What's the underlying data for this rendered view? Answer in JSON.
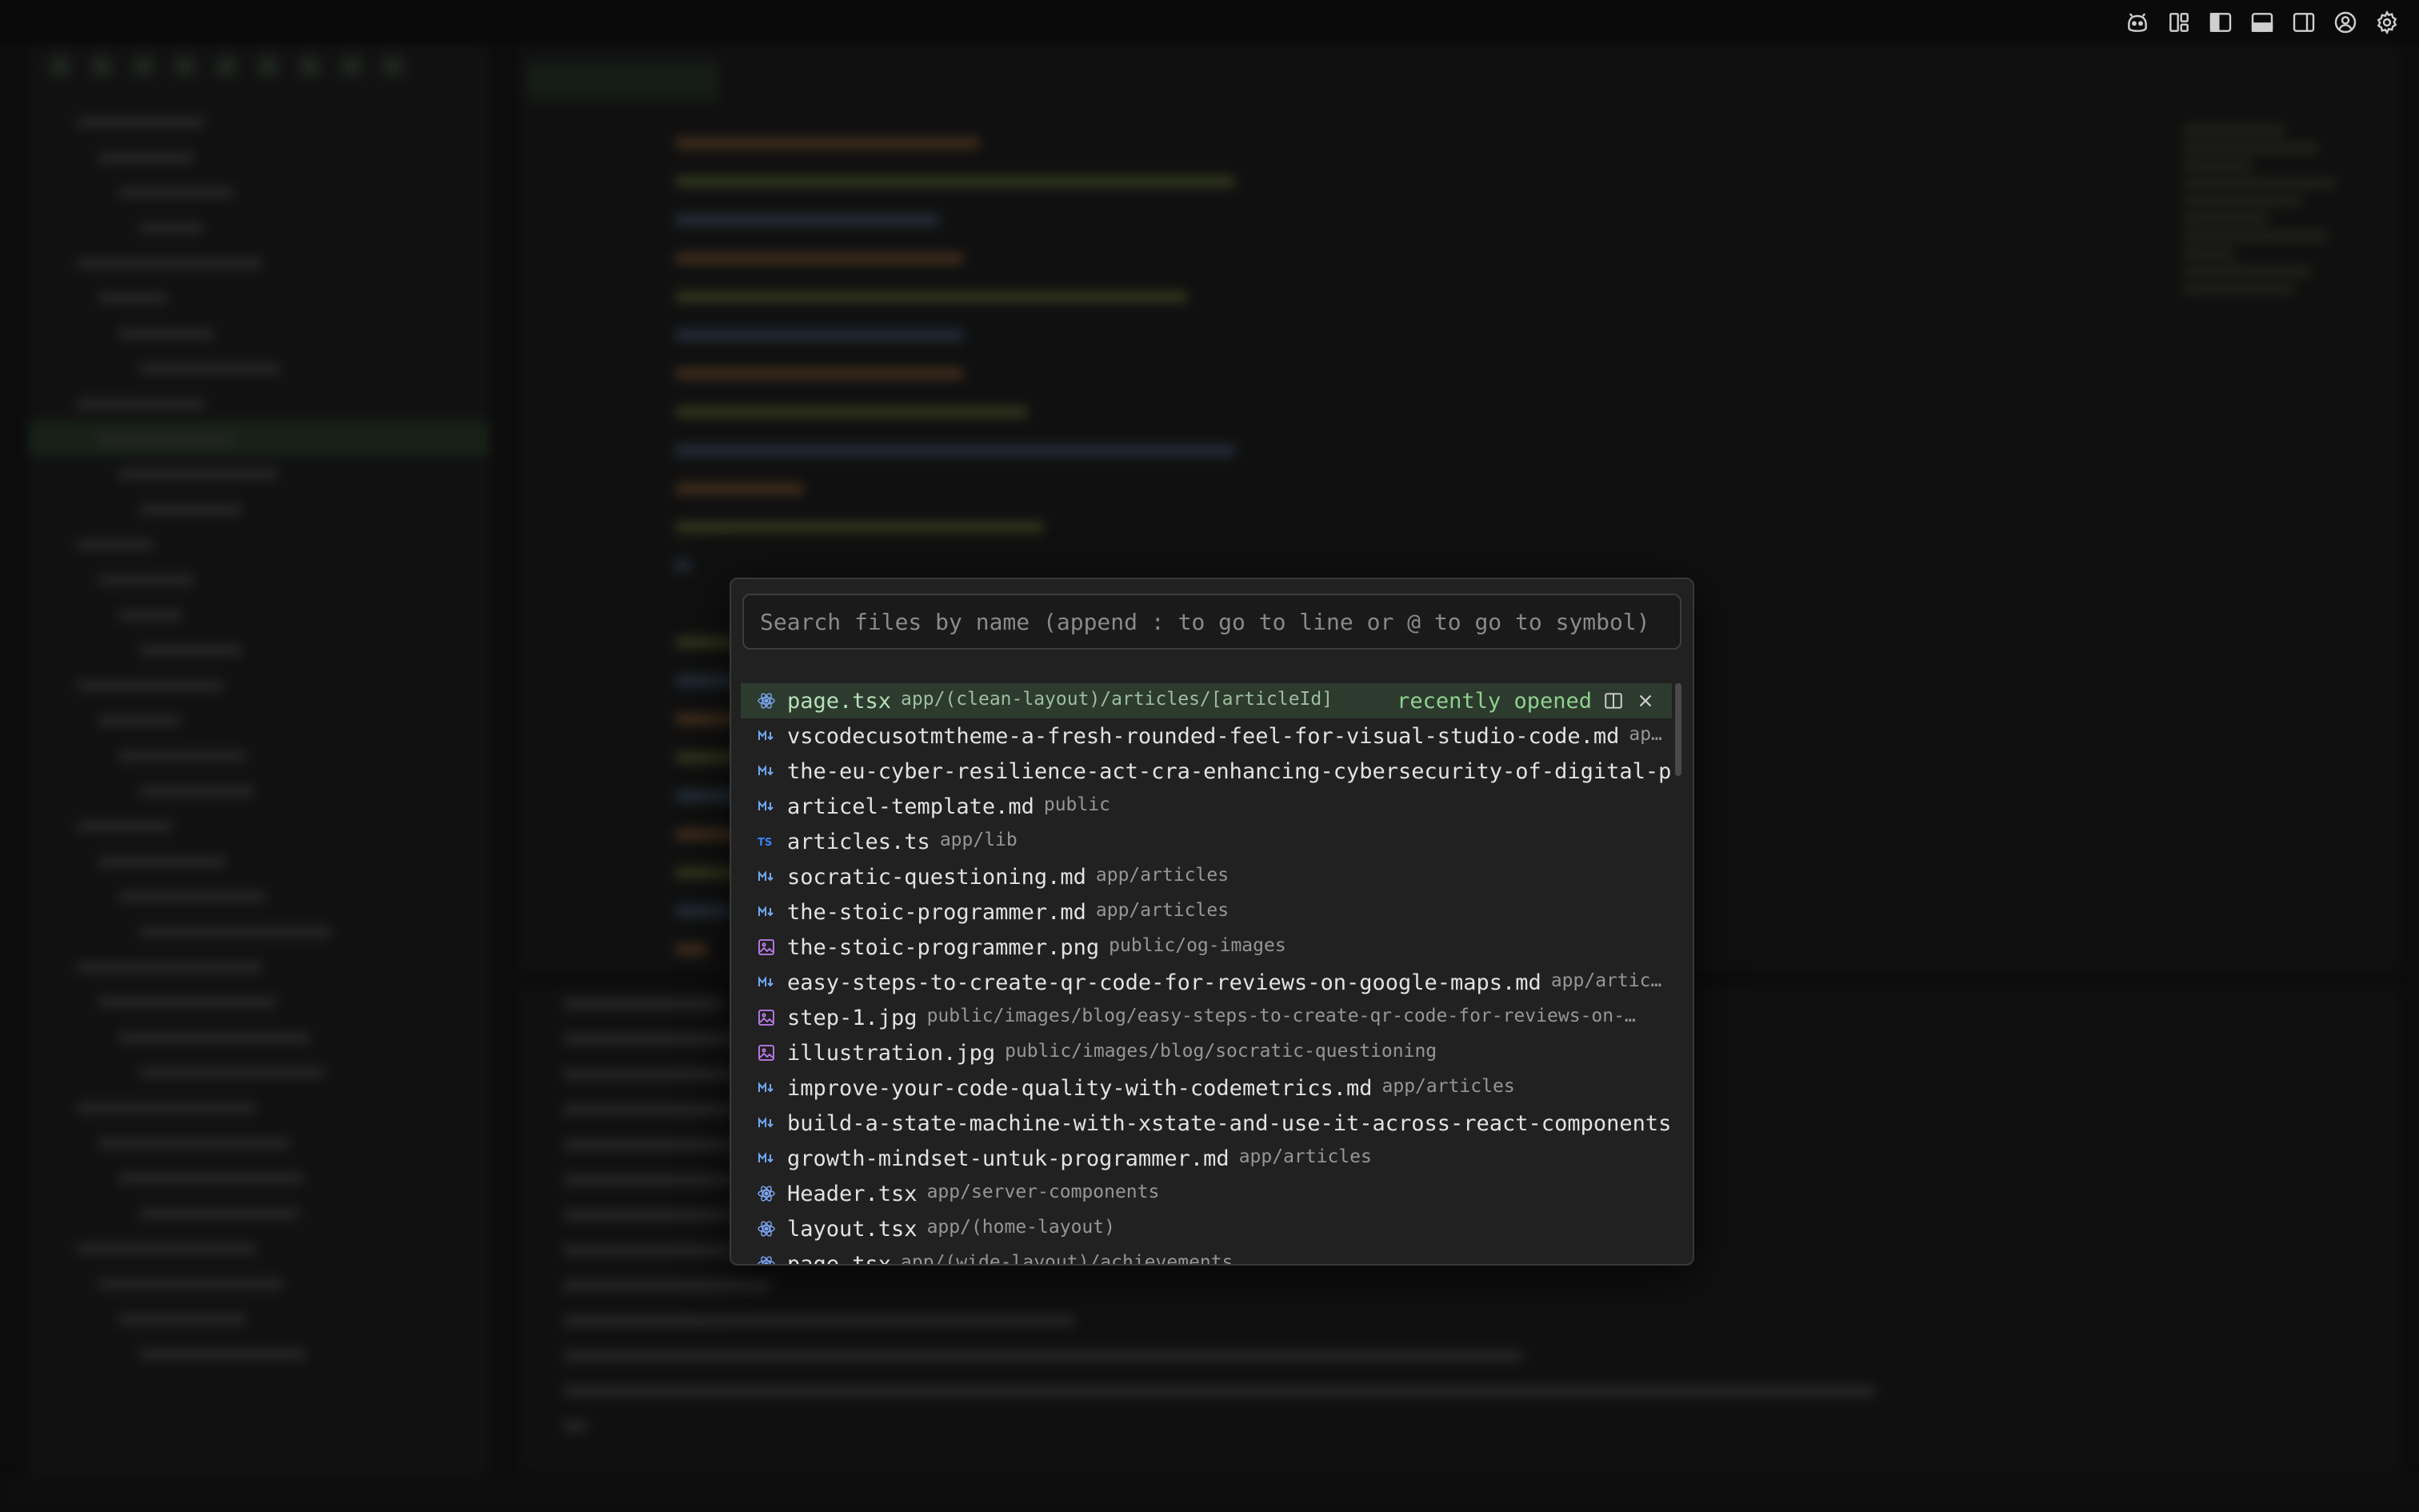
{
  "quick_open": {
    "placeholder": "Search files by name (append : to go to line or @ to go to symbol)",
    "recent_label": "recently opened",
    "results": [
      {
        "icon": "react-icon",
        "name": "page.tsx",
        "path": "app/(clean-layout)/articles/[articleId]",
        "selected": true
      },
      {
        "icon": "markdown-icon",
        "name": "vscodecusotmtheme-a-fresh-rounded-feel-for-visual-studio-code.md",
        "path": "app…"
      },
      {
        "icon": "markdown-icon",
        "name": "the-eu-cyber-resilience-act-cra-enhancing-cybersecurity-of-digital-p…",
        "path": ""
      },
      {
        "icon": "markdown-icon",
        "name": "articel-template.md",
        "path": "public"
      },
      {
        "icon": "typescript-icon",
        "name": "articles.ts",
        "path": "app/lib"
      },
      {
        "icon": "markdown-icon",
        "name": "socratic-questioning.md",
        "path": "app/articles"
      },
      {
        "icon": "markdown-icon",
        "name": "the-stoic-programmer.md",
        "path": "app/articles"
      },
      {
        "icon": "image-icon",
        "name": "the-stoic-programmer.png",
        "path": "public/og-images"
      },
      {
        "icon": "markdown-icon",
        "name": "easy-steps-to-create-qr-code-for-reviews-on-google-maps.md",
        "path": "app/articl…"
      },
      {
        "icon": "image-icon",
        "name": "step-1.jpg",
        "path": "public/images/blog/easy-steps-to-create-qr-code-for-reviews-on-…"
      },
      {
        "icon": "image-icon",
        "name": "illustration.jpg",
        "path": "public/images/blog/socratic-questioning"
      },
      {
        "icon": "markdown-icon",
        "name": "improve-your-code-quality-with-codemetrics.md",
        "path": "app/articles"
      },
      {
        "icon": "markdown-icon",
        "name": "build-a-state-machine-with-xstate-and-use-it-across-react-components…",
        "path": ""
      },
      {
        "icon": "markdown-icon",
        "name": "growth-mindset-untuk-programmer.md",
        "path": "app/articles"
      },
      {
        "icon": "react-icon",
        "name": "Header.tsx",
        "path": "app/server-components"
      },
      {
        "icon": "react-icon",
        "name": "layout.tsx",
        "path": "app/(home-layout)"
      },
      {
        "icon": "react-icon",
        "name": "page.tsx",
        "path": "app/(wide-layout)/achievements"
      }
    ]
  },
  "top_bar": {
    "icons": [
      "copilot-icon",
      "layout-customize-icon",
      "toggle-primary-sidebar-icon",
      "toggle-panel-icon",
      "toggle-secondary-sidebar-icon",
      "account-icon",
      "settings-gear-icon"
    ]
  },
  "colors": {
    "background": "#0c0c0c",
    "palette_bg": "#212121",
    "selected_row": "#2d3a2e",
    "accent_green": "#8fd18f",
    "markdown_icon": "#6fa8f0",
    "react_icon": "#7da7f5",
    "image_icon": "#c07ff2",
    "typescript_icon": "#3b82f6"
  }
}
